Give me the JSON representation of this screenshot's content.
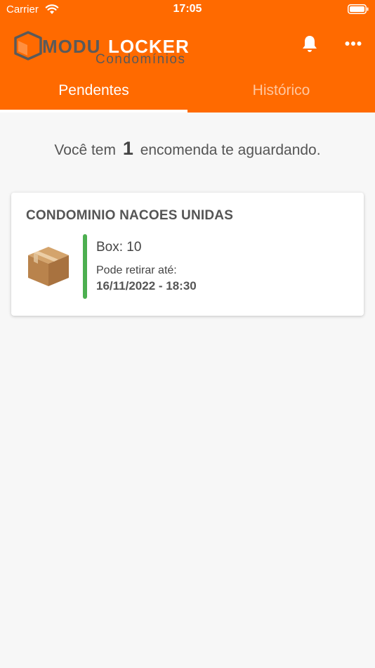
{
  "status_bar": {
    "carrier": "Carrier",
    "time": "17:05"
  },
  "header": {
    "logo_alt": "MODULOCKER Condomínios",
    "bell_icon": "bell-icon",
    "more_icon": "more-horizontal-icon",
    "color": "#ff6a00"
  },
  "tabs": [
    {
      "label": "Pendentes",
      "active": true
    },
    {
      "label": "Histórico",
      "active": false
    }
  ],
  "summary": {
    "prefix": "Você tem",
    "count": "1",
    "suffix": "encomenda te aguardando."
  },
  "packages": [
    {
      "condominium": "CONDOMINIO NACOES UNIDAS",
      "box": "Box: 10",
      "pickup_label": "Pode retirar até:",
      "pickup_deadline": "16/11/2022 - 18:30",
      "status_color": "#4caf50",
      "icon": "package-box-icon"
    }
  ]
}
